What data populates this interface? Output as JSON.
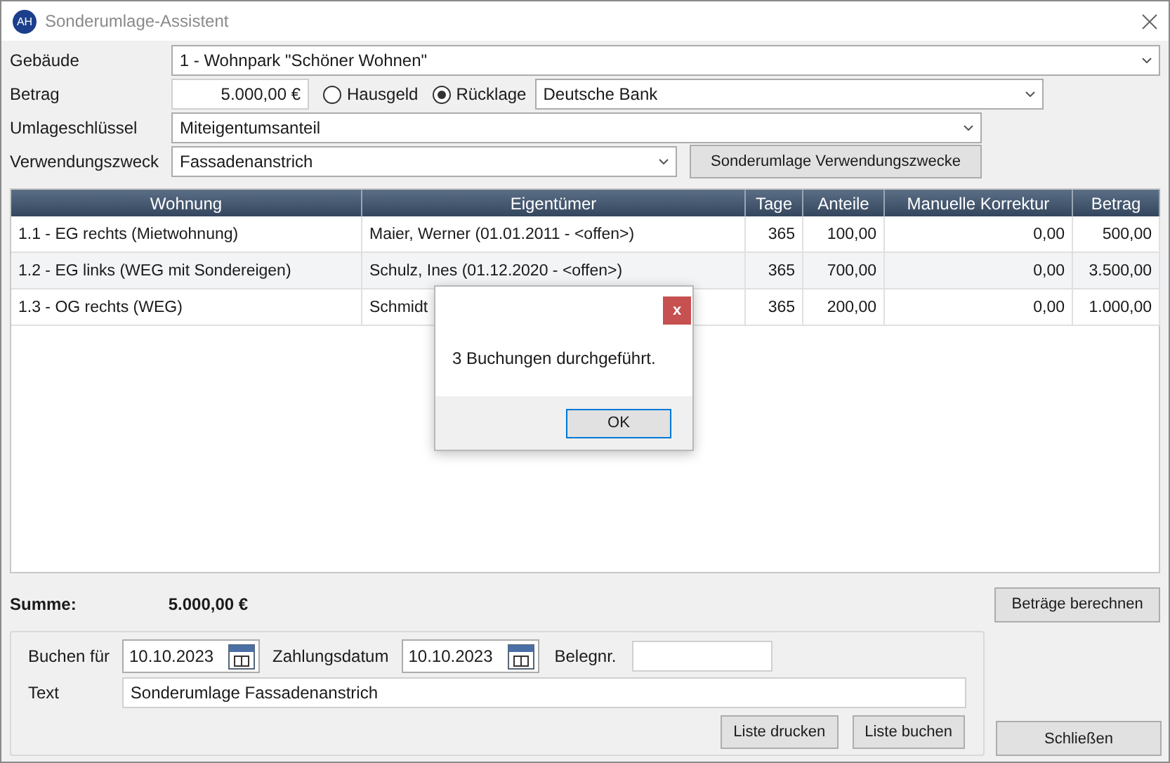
{
  "window": {
    "logo": "AH",
    "title": "Sonderumlage-Assistent"
  },
  "form": {
    "building": {
      "label": "Gebäude",
      "value": "1 - Wohnpark \"Schöner Wohnen\""
    },
    "amount": {
      "label": "Betrag",
      "value": "5.000,00 €"
    },
    "payment_types": [
      {
        "label": "Hausgeld",
        "selected": false
      },
      {
        "label": "Rücklage",
        "selected": true
      }
    ],
    "bank": {
      "value": "Deutsche Bank"
    },
    "allocation_key": {
      "label": "Umlageschlüssel",
      "value": "Miteigentumsanteil"
    },
    "purpose": {
      "label": "Verwendungszweck",
      "value": "Fassadenanstrich"
    },
    "purpose_button": "Sonderumlage Verwendungszwecke"
  },
  "table": {
    "columns": [
      "Wohnung",
      "Eigentümer",
      "Tage",
      "Anteile",
      "Manuelle Korrektur",
      "Betrag"
    ],
    "rows": [
      [
        "1.1 - EG rechts (Mietwohnung)",
        "Maier, Werner (01.01.2011 - <offen>)",
        "365",
        "100,00",
        "0,00",
        "500,00"
      ],
      [
        "1.2 - EG links (WEG mit Sondereigen)",
        "Schulz, Ines (01.12.2020 - <offen>)",
        "365",
        "700,00",
        "0,00",
        "3.500,00"
      ],
      [
        "1.3 - OG rechts (WEG)",
        "Schmidt",
        "365",
        "200,00",
        "0,00",
        "1.000,00"
      ]
    ]
  },
  "summary": {
    "label": "Summe:",
    "value": "5.000,00 €",
    "calculate_button": "Beträge berechnen"
  },
  "booking": {
    "book_for": {
      "label": "Buchen für",
      "value": "10.10.2023"
    },
    "payment_date": {
      "label": "Zahlungsdatum",
      "value": "10.10.2023"
    },
    "receipt_no": {
      "label": "Belegnr."
    },
    "text": {
      "label": "Text",
      "value": "Sonderumlage Fassadenanstrich"
    },
    "buttons": [
      "Liste drucken",
      "Liste buchen"
    ]
  },
  "close_button": "Schließen",
  "dialog": {
    "close": "x",
    "message": "3 Buchungen durchgeführt.",
    "ok": "OK"
  }
}
